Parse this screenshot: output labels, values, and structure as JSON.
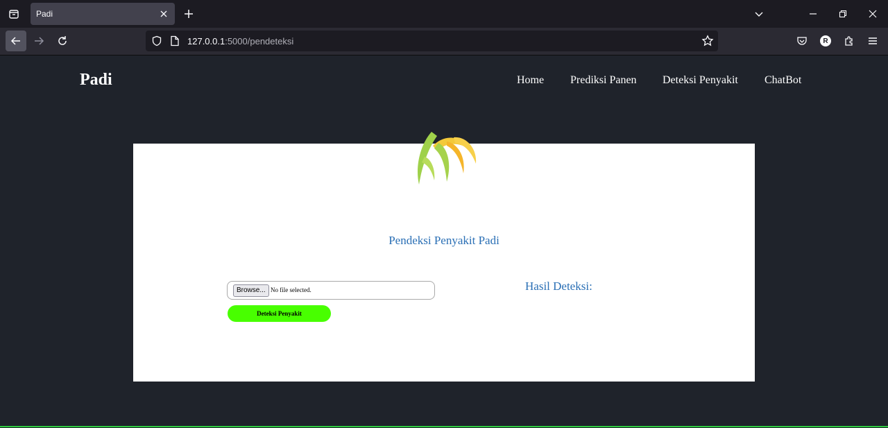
{
  "browser": {
    "tab_title": "Padi",
    "url_host": "127.0.0.1",
    "url_path": ":5000/pendeteksi",
    "profile_initial": "R"
  },
  "site": {
    "brand": "Padi",
    "nav": {
      "home": "Home",
      "prediksi": "Prediksi Panen",
      "deteksi": "Deteksi Penyakit",
      "chatbot": "ChatBot"
    },
    "page_title": "Pendeksi Penyakit Padi",
    "file_input": {
      "browse_label": "Browse...",
      "status": "No file selected."
    },
    "detect_button": "Deteksi Penyakit",
    "result_label": "Hasil Deteksi:"
  },
  "colors": {
    "page_bg": "#1f232b",
    "accent_blue": "#2a6fb5",
    "button_green": "#48ff00"
  }
}
